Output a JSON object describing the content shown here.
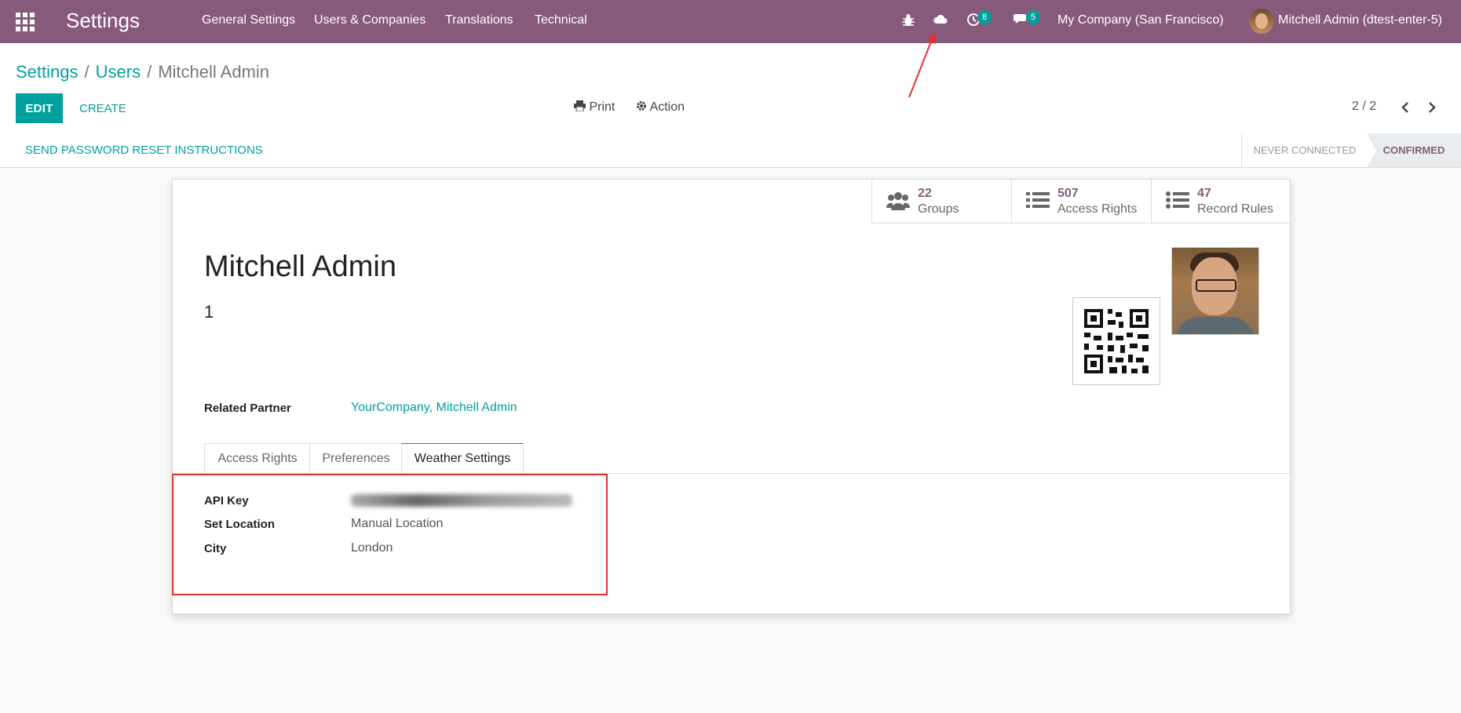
{
  "navbar": {
    "app_name": "Settings",
    "menus": [
      "General Settings",
      "Users & Companies",
      "Translations",
      "Technical"
    ],
    "activity_count": "8",
    "message_count": "5",
    "company": "My Company (San Francisco)",
    "user": "Mitchell Admin (dtest-enter-5)"
  },
  "breadcrumb": {
    "root": "Settings",
    "parent": "Users",
    "current": "Mitchell Admin"
  },
  "buttons": {
    "edit": "EDIT",
    "create": "CREATE",
    "print": "Print",
    "action": "Action"
  },
  "pager": "2 / 2",
  "statusbar": {
    "reset": "SEND PASSWORD RESET INSTRUCTIONS",
    "states": [
      "NEVER CONNECTED",
      "CONFIRMED"
    ],
    "active_state": "CONFIRMED"
  },
  "stats": [
    {
      "value": "22",
      "label": "Groups",
      "icon": "users-icon"
    },
    {
      "value": "507",
      "label": "Access Rights",
      "icon": "list-icon"
    },
    {
      "value": "47",
      "label": "Record Rules",
      "icon": "list-ul-icon"
    }
  ],
  "user": {
    "name": "Mitchell Admin",
    "login": "1"
  },
  "fields": {
    "related_partner_label": "Related Partner",
    "related_partner_value": "YourCompany, Mitchell Admin"
  },
  "tabs": [
    "Access Rights",
    "Preferences",
    "Weather Settings"
  ],
  "active_tab": "Weather Settings",
  "weather": {
    "api_key_label": "API Key",
    "set_location_label": "Set Location",
    "set_location_value": "Manual Location",
    "city_label": "City",
    "city_value": "London"
  },
  "colors": {
    "brand": "#875a7b",
    "accent": "#00a09d",
    "annotation": "#e62e2e"
  }
}
